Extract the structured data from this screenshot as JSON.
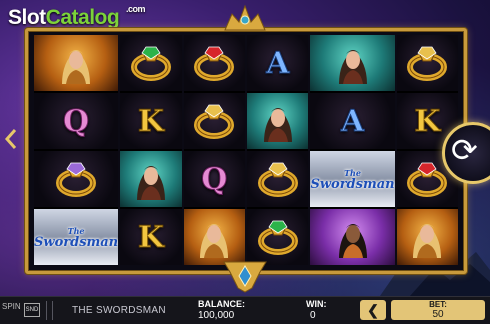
{
  "watermark": {
    "slot": "Slot",
    "catalog": "Catalog",
    "com": ".com"
  },
  "reels": [
    [
      "portrait-blonde",
      "Q",
      "ring-purple",
      "swordsman"
    ],
    [
      "ring-green",
      "K",
      "portrait-brunette-teal",
      "K"
    ],
    [
      "ring-red",
      "ring-gold",
      "Q",
      "portrait-blonde"
    ],
    [
      "A",
      "portrait-brunette-teal",
      "ring-gold",
      "ring-green"
    ],
    [
      "portrait-brunette-teal",
      "A",
      "swordsman",
      "portrait-dark-purple"
    ],
    [
      "ring-gold",
      "K",
      "ring-red",
      "portrait-blonde"
    ]
  ],
  "symbols": {
    "swordsman_the": "The",
    "swordsman_name": "Swordsman"
  },
  "footer": {
    "game_title": "THE SWORDSMAN",
    "balance_label": "BALANCE:",
    "balance_value": "100,000",
    "win_label": "WIN:",
    "win_value": "0",
    "bet_label": "BET:",
    "bet_value": "50",
    "bet_decrease": "❮",
    "sound_label": "SND",
    "logo_label": "SPIN"
  },
  "spin_icon": "⟳",
  "colors": {
    "frame_gold": "#c89a3c",
    "bet_gold": "#e3c577",
    "watermark_green": "#7bd33a"
  }
}
